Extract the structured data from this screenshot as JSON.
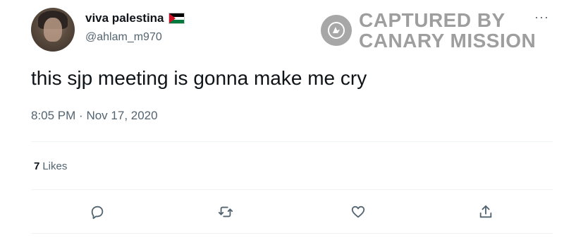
{
  "tweet": {
    "display_name": "viva palestina",
    "flag_icon": "palestine-flag-icon",
    "handle": "@ahlam_m970",
    "text": "this sjp meeting is gonna make me cry",
    "time": "8:05 PM",
    "separator": "·",
    "date": "Nov 17, 2020",
    "likes_count": "7",
    "likes_label": "Likes",
    "more_label": "···"
  },
  "watermark": {
    "line1": "CAPTURED BY",
    "line2": "CANARY MISSION",
    "icon": "canary-logo-icon"
  },
  "actions": [
    {
      "icon": "reply-icon"
    },
    {
      "icon": "retweet-icon"
    },
    {
      "icon": "like-icon"
    },
    {
      "icon": "share-icon"
    }
  ],
  "colors": {
    "text_primary": "#0f1419",
    "text_secondary": "#536471",
    "divider": "#eff3f4",
    "watermark": "#9e9e9e"
  }
}
